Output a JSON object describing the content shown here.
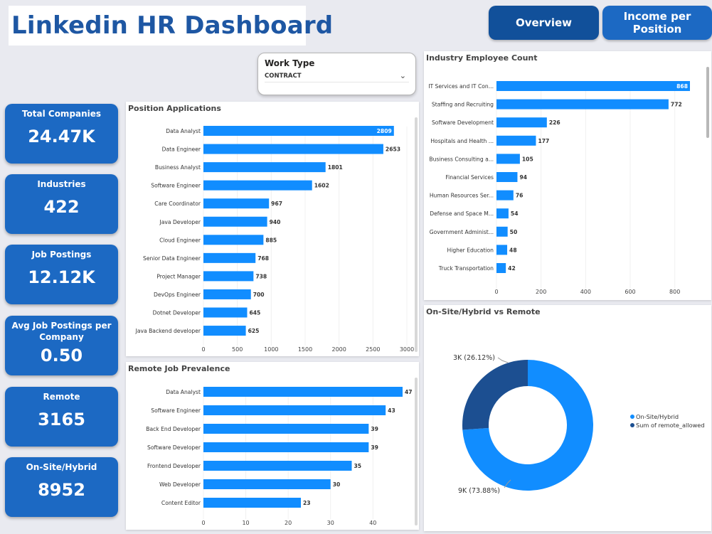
{
  "header": {
    "title": "Linkedin HR Dashboard"
  },
  "nav": {
    "overview": "Overview",
    "income": "Income per Position"
  },
  "slicer": {
    "title": "Work Type",
    "value": "CONTRACT",
    "icon": "chevron-down-icon"
  },
  "kpis": [
    {
      "label": "Total Companies",
      "value": "24.47K"
    },
    {
      "label": "Industries",
      "value": "422"
    },
    {
      "label": "Job Postings",
      "value": "12.12K"
    },
    {
      "label": "Avg Job Postings per Company",
      "value": "0.50"
    },
    {
      "label": "Remote",
      "value": "3165"
    },
    {
      "label": "On-Site/Hybrid",
      "value": "8952"
    }
  ],
  "colors": {
    "bar": "#118dff",
    "dark": "#12239e",
    "donut_dark": "#1c4f91",
    "kpi": "#1c69c3",
    "title": "#1e57a3"
  },
  "chart_data": [
    {
      "id": "positions",
      "type": "bar",
      "orientation": "horizontal",
      "title": "Position Applications",
      "categories": [
        "Data Analyst",
        "Data Engineer",
        "Business Analyst",
        "Software Engineer",
        "Care Coordinator",
        "Java Developer",
        "Cloud Engineer",
        "Senior Data Engineer",
        "Project Manager",
        "DevOps Engineer",
        "Dotnet Developer",
        "Java Backend developer"
      ],
      "values": [
        2809,
        2653,
        1801,
        1602,
        967,
        940,
        885,
        768,
        738,
        700,
        645,
        625
      ],
      "value_labels": [
        "2809",
        "2653",
        "1801",
        "1602",
        "967",
        "940",
        "885",
        "768",
        "738",
        "700",
        "645",
        "625"
      ],
      "ticks": [
        0,
        500,
        1000,
        1500,
        2000,
        2500,
        3000
      ],
      "xlim": [
        0,
        3000
      ]
    },
    {
      "id": "remote",
      "type": "bar",
      "orientation": "horizontal",
      "title": "Remote Job Prevalence",
      "categories": [
        "Data Analyst",
        "Software Engineer",
        "Back End Developer",
        "Software Developer",
        "Frontend Developer",
        "Web Developer",
        "Content Editor"
      ],
      "values": [
        47,
        43,
        39,
        39,
        35,
        30,
        23
      ],
      "value_labels": [
        "47",
        "43",
        "39",
        "39",
        "35",
        "30",
        "23"
      ],
      "ticks": [
        0,
        10,
        20,
        30,
        40
      ],
      "xlim": [
        0,
        47
      ]
    },
    {
      "id": "industry",
      "type": "bar",
      "orientation": "horizontal",
      "title": "Industry Employee Count",
      "categories": [
        "IT Services and IT Con...",
        "Staffing and Recruiting",
        "Software Development",
        "Hospitals and Health ...",
        "Business Consulting a...",
        "Financial Services",
        "Human Resources Ser...",
        "Defense and Space M...",
        "Government Administ...",
        "Higher Education",
        "Truck Transportation"
      ],
      "values": [
        868,
        772,
        226,
        177,
        105,
        94,
        76,
        54,
        50,
        48,
        42
      ],
      "value_labels": [
        "868",
        "772",
        "226",
        "177",
        "105",
        "94",
        "76",
        "54",
        "50",
        "48",
        "42"
      ],
      "ticks": [
        0,
        200,
        400,
        600,
        800
      ],
      "xlim": [
        0,
        868
      ]
    },
    {
      "id": "donut",
      "type": "pie",
      "title": "On-Site/Hybrid vs Remote",
      "series": [
        {
          "name": "On-Site/Hybrid",
          "value": 73.88,
          "label": "9K (73.88%)",
          "color": "#118dff"
        },
        {
          "name": "Sum of remote_allowed",
          "value": 26.12,
          "label": "3K (26.12%)",
          "color": "#1c4f91"
        }
      ],
      "legend": "right"
    }
  ]
}
